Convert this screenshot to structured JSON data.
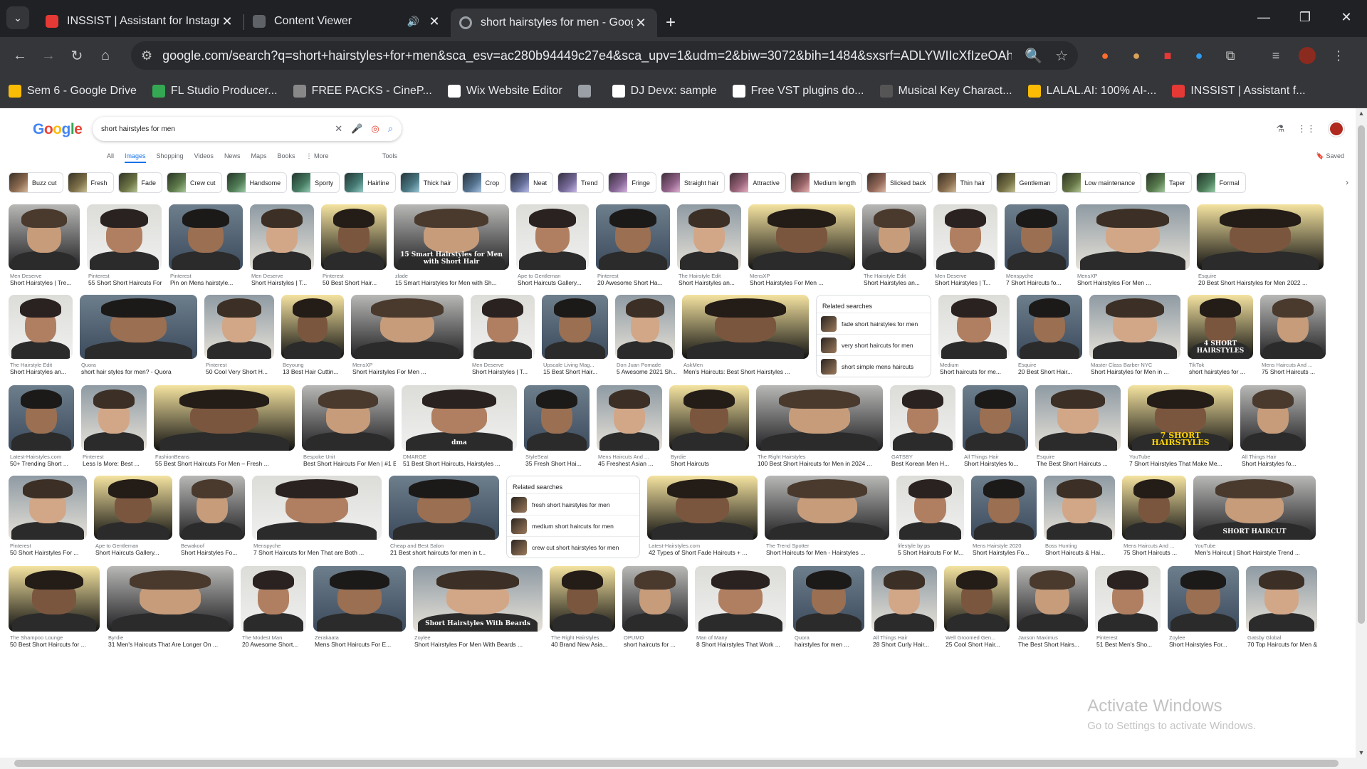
{
  "browser": {
    "tabs": [
      {
        "title": "INSSIST | Assistant for Instagram",
        "favicon_color": "#e53935",
        "active": false,
        "audio": false
      },
      {
        "title": "Content Viewer",
        "favicon_color": "#5f6368",
        "active": false,
        "audio": true
      },
      {
        "title": "short hairstyles for men - Google",
        "favicon_color": "#ffffff",
        "active": true,
        "audio": false
      }
    ],
    "url": "google.com/search?q=short+hairstyles+for+men&sca_esv=ac280b94449c27e4&sca_upv=1&udm=2&biw=3072&bih=1484&sxsrf=ADLYWIIcXfIzeOAh9...",
    "bookmarks": [
      {
        "label": "Sem 6 - Google Drive",
        "color": "#fbbc05"
      },
      {
        "label": "FL Studio Producer...",
        "color": "#34a853"
      },
      {
        "label": "FREE PACKS - CineP...",
        "color": "#888888"
      },
      {
        "label": "Wix Website Editor",
        "color": "#ffffff"
      },
      {
        "label": "",
        "color": "#9aa0a6"
      },
      {
        "label": "DJ Devx: sample",
        "color": "#ffffff"
      },
      {
        "label": "Free VST plugins do...",
        "color": "#ffffff"
      },
      {
        "label": "Musical Key Charact...",
        "color": "#555555"
      },
      {
        "label": "LALAL.AI: 100% AI-...",
        "color": "#fbbc05"
      },
      {
        "label": "INSSIST | Assistant f...",
        "color": "#e53935"
      }
    ]
  },
  "google": {
    "logo": [
      "G",
      "o",
      "o",
      "g",
      "l",
      "e"
    ],
    "query": "short hairstyles for men",
    "nav": [
      "All",
      "Images",
      "Shopping",
      "Videos",
      "News",
      "Maps",
      "Books",
      "⋮ More"
    ],
    "active_nav": "Images",
    "tools": "Tools",
    "saved": "Saved",
    "chips": [
      "Buzz cut",
      "Fresh",
      "Fade",
      "Crew cut",
      "Handsome",
      "Sporty",
      "Hairline",
      "Thick hair",
      "Crop",
      "Neat",
      "Trend",
      "Fringe",
      "Straight hair",
      "Attractive",
      "Medium length",
      "Slicked back",
      "Thin hair",
      "Gentleman",
      "Low maintenance",
      "Taper",
      "Formal"
    ]
  },
  "results": [
    [
      {
        "src": "Men Deserve",
        "title": "Short Hairstyles | Tre...",
        "w": 100
      },
      {
        "src": "Pinterest",
        "title": "55 Short Short Haircuts For ...",
        "w": 105
      },
      {
        "src": "Pinterest",
        "title": "Pin on Mens hairstyle...",
        "w": 104
      },
      {
        "src": "Men Deserve",
        "title": "Short Hairstyles | T...",
        "w": 90
      },
      {
        "src": "Pinterest",
        "title": "50 Best Short Hair...",
        "w": 92
      },
      {
        "src": "zlade",
        "title": "15 Smart Hairstyles for Men with Sh...",
        "w": 162,
        "overlay": "15 Smart Hairstyles for Men with Short Hair"
      },
      {
        "src": "Ape to Gentleman",
        "title": "Short Haircuts Gallery...",
        "w": 102
      },
      {
        "src": "Pinterest",
        "title": "20 Awesome Short Ha...",
        "w": 104
      },
      {
        "src": "The Hairstyle Edit",
        "title": "Short Hairstyles an...",
        "w": 90
      },
      {
        "src": "MensXP",
        "title": "Short Hairstyles For Men ...",
        "w": 150
      },
      {
        "src": "The Hairstyle Edit",
        "title": "Short Hairstyles an...",
        "w": 90
      },
      {
        "src": "Men Deserve",
        "title": "Short Hairstyles | T...",
        "w": 90
      },
      {
        "src": "Menspyche",
        "title": "7 Short Haircuts fo...",
        "w": 90
      },
      {
        "src": "MensXP",
        "title": "Short Hairstyles For Men ...",
        "w": 160
      },
      {
        "src": "Esquire",
        "title": "20 Best Short Hairstyles for Men 2022 ...",
        "w": 178
      }
    ],
    [
      {
        "src": "The Hairstyle Edit",
        "title": "Short Hairstyles an...",
        "w": 90
      },
      {
        "src": "Quora",
        "title": "short hair styles for men? - Quora",
        "w": 165
      },
      {
        "src": "Pinterest",
        "title": "50 Cool Very Short H...",
        "w": 98
      },
      {
        "src": "Beyoung",
        "title": "13 Best Hair Cuttin...",
        "w": 88
      },
      {
        "src": "MensXP",
        "title": "Short Hairstyles For Men ...",
        "w": 158
      },
      {
        "src": "Men Deserve",
        "title": "Short Hairstyles | T...",
        "w": 90
      },
      {
        "src": "Upscale Living Mag...",
        "title": "15 Best Short Hair...",
        "w": 93
      },
      {
        "src": "Don Juan Pomade",
        "title": "5 Awesome 2021 Sh...",
        "w": 84
      },
      {
        "src": "AskMen",
        "title": "Men's Haircuts: Best Short Hairstyles ...",
        "w": 178
      },
      {
        "related": true,
        "w": 162,
        "heading": "Related searches",
        "items": [
          {
            "pre": "fade",
            "post": " short hairstyles for men"
          },
          {
            "pre": "very",
            "post": " short haircuts for men"
          },
          {
            "pre": "short simple mens haircuts",
            "post": ""
          }
        ]
      },
      {
        "src": "Medium",
        "title": "Short haircuts for me...",
        "w": 100
      },
      {
        "src": "Esquire",
        "title": "20 Best Short Hair...",
        "w": 92
      },
      {
        "src": "Master Class Barber NYC",
        "title": "Short Hairstyles for Men in ...",
        "w": 128
      },
      {
        "src": "TikTok",
        "title": "short hairstyles for ...",
        "w": 92,
        "overlay": "4 SHORT HAIRSTYLES"
      },
      {
        "src": "Mens Haircuts And ...",
        "title": "75 Short Haircuts ...",
        "w": 92
      }
    ],
    [
      {
        "src": "Latest-Hairstyles.com",
        "title": "50+ Trending Short ...",
        "w": 92
      },
      {
        "src": "Pinterest",
        "title": "Less Is More: Best ...",
        "w": 92
      },
      {
        "src": "FashionBeans",
        "title": "55 Best Short Haircuts For Men – Fresh ...",
        "w": 198
      },
      {
        "src": "Bespoke Unit",
        "title": "Best Short Haircuts For Men | #1 Be...",
        "w": 130
      },
      {
        "src": "DMARGE",
        "title": "51 Best Short Haircuts, Hairstyles ...",
        "w": 162,
        "overlay": "dma"
      },
      {
        "src": "StyleSeat",
        "title": "35 Fresh Short Hai...",
        "w": 92
      },
      {
        "src": "Mens Haircuts And ...",
        "title": "45 Freshest Asian ...",
        "w": 92
      },
      {
        "src": "Byrdie",
        "title": "Short Haircuts",
        "w": 112
      },
      {
        "src": "The Right Hairstyles",
        "title": "100 Best Short Haircuts for Men in 2024 ...",
        "w": 178
      },
      {
        "src": "GATSBY",
        "title": "Best Korean Men H...",
        "w": 92
      },
      {
        "src": "All Things Hair",
        "title": "Short Hairstyles fo...",
        "w": 92
      },
      {
        "src": "Esquire",
        "title": "The Best Short Haircuts ...",
        "w": 120
      },
      {
        "src": "YouTube",
        "title": "7 Short Hairstyles That Make Me...",
        "w": 148,
        "overlay": "7 SHORT HAIRSTYLES"
      },
      {
        "src": "All Things Hair",
        "title": "Short Hairstyles fo...",
        "w": 92
      }
    ],
    [
      {
        "src": "Pinterest",
        "title": "50 Short Hairstyles For ...",
        "w": 110
      },
      {
        "src": "Ape to Gentleman",
        "title": "Short Haircuts Gallery...",
        "w": 110
      },
      {
        "src": "Bewakoof",
        "title": "Short Hairstyles Fo...",
        "w": 92
      },
      {
        "src": "Menspyche",
        "title": "7 Short Haircuts for Men That are Both ...",
        "w": 182
      },
      {
        "src": "Cheap and Best Salon",
        "title": "21 Best short haircuts for men in t...",
        "w": 155
      },
      {
        "related": true,
        "w": 188,
        "heading": "Related searches",
        "items": [
          {
            "pre": "fresh",
            "post": " short hairstyles for men"
          },
          {
            "pre": "medium",
            "post": " short haircuts for men"
          },
          {
            "pre": "crew cut",
            "post": " short hairstyles for men"
          }
        ]
      },
      {
        "src": "Latest-Hairstyles.com",
        "title": "42 Types of Short Fade Haircuts + ...",
        "w": 155
      },
      {
        "src": "The Trend Spotter",
        "title": "Short Haircuts for Men - Hairstyles ...",
        "w": 175
      },
      {
        "src": "lifestyle by ps",
        "title": "5 Short Haircuts For M...",
        "w": 95
      },
      {
        "src": "Mens Hairstyle 2020",
        "title": "Short Hairstyles Fo...",
        "w": 92
      },
      {
        "src": "Boss Hunting",
        "title": "Short Haircuts & Hai...",
        "w": 100
      },
      {
        "src": "Mens Haircuts And ...",
        "title": "75 Short Haircuts ...",
        "w": 90
      },
      {
        "src": "YouTube",
        "title": "Men's Haircut | Short Hairstyle Trend ...",
        "w": 172,
        "overlay": "SHORT HAIRCUT"
      }
    ],
    [
      {
        "src": "The Shampoo Lounge",
        "title": "50 Best Short Haircuts for ...",
        "w": 128
      },
      {
        "src": "Byrdie",
        "title": "31 Men's Haircuts That Are Longer On ...",
        "w": 178
      },
      {
        "src": "The Modest Man",
        "title": "20 Awesome Short...",
        "w": 92
      },
      {
        "src": "Zerakaata",
        "title": "Mens Short Haircuts For E...",
        "w": 130
      },
      {
        "src": "Zoylee",
        "title": "Short Hairstyles For Men With Beards ...",
        "w": 182,
        "overlay": "Short Hairstyles With Beards"
      },
      {
        "src": "The Right Hairstyles",
        "title": "40 Brand New Asia...",
        "w": 92
      },
      {
        "src": "OPUMO",
        "title": "short haircuts for ...",
        "w": 92
      },
      {
        "src": "Man of Many",
        "title": "8 Short Hairstyles That Work ...",
        "w": 128
      },
      {
        "src": "Quora",
        "title": "hairstyles for men ...",
        "w": 100
      },
      {
        "src": "All Things Hair",
        "title": "28 Short Curly Hair...",
        "w": 92
      },
      {
        "src": "Well Groomed Gen...",
        "title": "25 Cool Short Hair...",
        "w": 92
      },
      {
        "src": "Jaxson Maximus",
        "title": "The Best Short Hairs...",
        "w": 100
      },
      {
        "src": "Pinterest",
        "title": "51 Best Men's Sho...",
        "w": 92
      },
      {
        "src": "Zoylee",
        "title": "Short Hairstyles For...",
        "w": 100
      },
      {
        "src": "Gatsby Global",
        "title": "70 Top Haircuts for Men & H...",
        "w": 100
      }
    ]
  ],
  "watermark": {
    "line1": "Activate Windows",
    "line2": "Go to Settings to activate Windows."
  }
}
